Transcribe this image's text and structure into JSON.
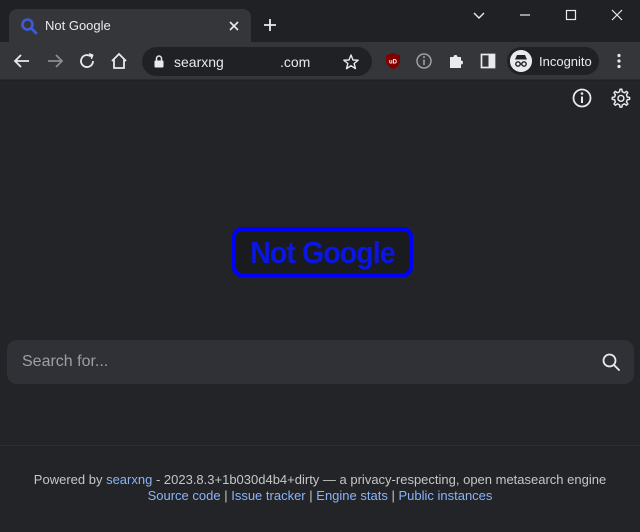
{
  "browser": {
    "tab_title": "Not Google",
    "url_prefix": "searxng",
    "url_suffix": ".com",
    "profile_label": "Incognito"
  },
  "page": {
    "logo_text": "Not Google",
    "search_placeholder": "Search for...",
    "footer": {
      "powered_by": "Powered by",
      "engine_link": "searxng",
      "version_text": "- 2023.8.3+1b030d4b4+dirty — a privacy-respecting, open metasearch engine",
      "links": [
        "Source code",
        "Issue tracker",
        "Engine stats",
        "Public instances"
      ],
      "separator": "|"
    }
  },
  "colors": {
    "logo": "#0000ff",
    "link": "#8ab4f8",
    "background": "#222428"
  }
}
